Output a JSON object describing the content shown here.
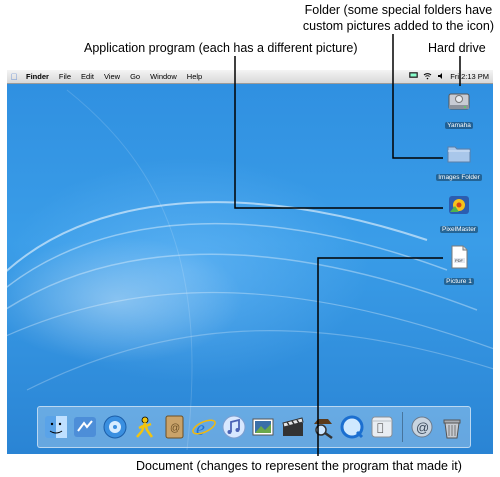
{
  "callouts": {
    "folder_line1": "Folder (some special folders have",
    "folder_line2": "custom pictures added to the icon)",
    "application": "Application program (each has a different picture)",
    "hard_drive": "Hard drive",
    "document": "Document (changes to represent the program that made it)"
  },
  "menubar": {
    "app_name": "Finder",
    "items": [
      "File",
      "Edit",
      "View",
      "Go",
      "Window",
      "Help"
    ],
    "clock": "Fri 2:13 PM"
  },
  "desktop_icons": [
    {
      "name": "hard-drive-icon",
      "label": "Yamaha"
    },
    {
      "name": "folder-icon",
      "label": "Images Folder"
    },
    {
      "name": "application-icon",
      "label": "PixelMaster"
    },
    {
      "name": "document-icon",
      "label": "Picture 1"
    }
  ],
  "dock": {
    "items": [
      "finder-icon",
      "mail-icon",
      "itunes-icon",
      "aim-icon",
      "address-book-icon",
      "internet-explorer-icon",
      "itunes-note-icon",
      "iphoto-icon",
      "imovie-icon",
      "sherlock-icon",
      "quicktime-icon",
      "system-preferences-icon",
      "mail-stamp-icon",
      "trash-icon"
    ]
  },
  "colors": {
    "desktop": "#2f8fe0",
    "menubar": "#e6e6e6"
  }
}
